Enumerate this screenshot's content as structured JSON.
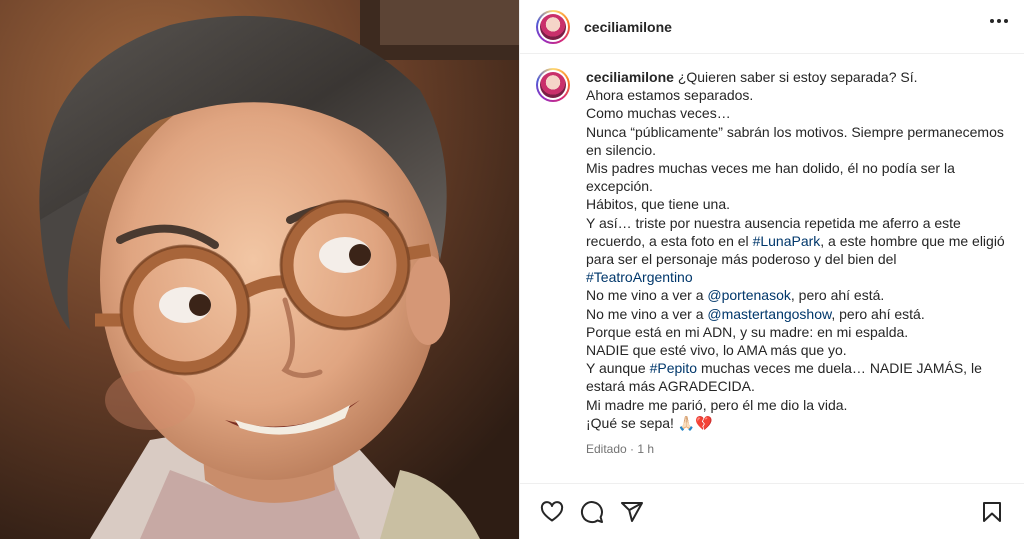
{
  "post": {
    "username": "ceciliamilone",
    "caption_lines": [
      {
        "parts": [
          {
            "text": "¿Quieren saber si estoy separada? Sí."
          }
        ]
      },
      {
        "parts": [
          {
            "text": "Ahora estamos separados."
          }
        ]
      },
      {
        "parts": [
          {
            "text": "Como muchas veces…"
          }
        ]
      },
      {
        "parts": [
          {
            "text": "Nunca “públicamente” sabrán los motivos. Siempre permanecemos en silencio."
          }
        ]
      },
      {
        "parts": [
          {
            "text": "Mis padres muchas veces me han dolido, él no podía ser la excepción."
          }
        ]
      },
      {
        "parts": [
          {
            "text": "Hábitos, que tiene una."
          }
        ]
      },
      {
        "parts": [
          {
            "text": "Y así… triste por nuestra ausencia repetida me aferro a este recuerdo, a esta foto en el "
          },
          {
            "text": "#LunaPark",
            "link": true
          },
          {
            "text": ", a este hombre que me eligió para ser el personaje más poderoso y del bien del "
          },
          {
            "text": "#TeatroArgentino",
            "link": true
          }
        ]
      },
      {
        "parts": [
          {
            "text": "No me vino a ver a "
          },
          {
            "text": "@portenasok",
            "link": true
          },
          {
            "text": ", pero ahí está."
          }
        ]
      },
      {
        "parts": [
          {
            "text": "No me vino a ver a "
          },
          {
            "text": "@mastertangoshow",
            "link": true
          },
          {
            "text": ", pero ahí está."
          }
        ]
      },
      {
        "parts": [
          {
            "text": "Porque está en mi ADN, y su madre: en mi espalda."
          }
        ]
      },
      {
        "parts": [
          {
            "text": "NADIE que esté vivo, lo AMA más que yo."
          }
        ]
      },
      {
        "parts": [
          {
            "text": "Y aunque "
          },
          {
            "text": "#Pepito",
            "link": true
          },
          {
            "text": " muchas veces me duela… NADIE JAMÁS, le estará más AGRADECIDA."
          }
        ]
      },
      {
        "parts": [
          {
            "text": "Mi madre me parió, pero él me dio la vida."
          }
        ]
      },
      {
        "parts": [
          {
            "text": "¡Qué se sepa! 🙏🏻💔"
          }
        ]
      }
    ],
    "meta": "Editado · 1 h"
  },
  "icons": {
    "more": "more-options-icon",
    "like": "heart-icon",
    "comment": "comment-icon",
    "share": "share-icon",
    "save": "bookmark-icon"
  },
  "colors": {
    "text": "#262626",
    "link": "#00376b",
    "muted": "#737373",
    "border": "#efefef"
  }
}
